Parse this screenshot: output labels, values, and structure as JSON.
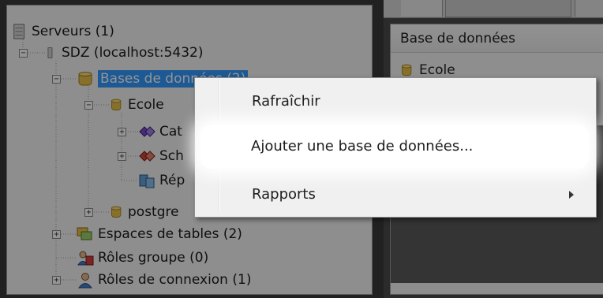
{
  "tree": {
    "servers_label": "Serveurs (1)",
    "server_label": "SDZ (localhost:5432)",
    "databases_label": "Bases de données (2)",
    "db_ecole_label": "Ecole",
    "catalogs_label": "Cat",
    "schemas_label": "Sch",
    "replication_label": "Rép",
    "db_postgres_label": "postgre",
    "tablespaces_label": "Espaces de tables (2)",
    "group_roles_label": "Rôles groupe (0)",
    "login_roles_label": "Rôles de connexion (1)"
  },
  "right_panel": {
    "column_header": "Base de données",
    "row_label": "Ecole"
  },
  "context_menu": {
    "refresh": "Rafraîchir",
    "add_database": "Ajouter une base de données...",
    "reports": "Rapports"
  },
  "colors": {
    "selection": "#3399ff",
    "menu_bg": "#f0f0f0",
    "db_icon": "#e8c24a"
  }
}
